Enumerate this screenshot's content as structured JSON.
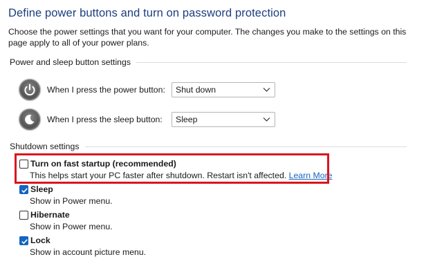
{
  "page": {
    "title": "Define power buttons and turn on password protection",
    "description": "Choose the power settings that you want for your computer. The changes you make to the settings on this page apply to all of your power plans."
  },
  "power_section": {
    "label": "Power and sleep button settings",
    "rows": [
      {
        "icon": "power-button-icon",
        "label": "When I press the power button:",
        "value": "Shut down"
      },
      {
        "icon": "sleep-button-icon",
        "label": "When I press the sleep button:",
        "value": "Sleep"
      }
    ]
  },
  "shutdown_section": {
    "label": "Shutdown settings",
    "options": [
      {
        "label": "Turn on fast startup (recommended)",
        "description": "This helps start your PC faster after shutdown. Restart isn't affected.",
        "link": "Learn More",
        "checked": false
      },
      {
        "label": "Sleep",
        "description": "Show in Power menu.",
        "checked": true
      },
      {
        "label": "Hibernate",
        "description": "Show in Power menu.",
        "checked": false
      },
      {
        "label": "Lock",
        "description": "Show in account picture menu.",
        "checked": true
      }
    ]
  },
  "colors": {
    "title": "#1c3e7f",
    "accent": "#1565c0",
    "highlight_border": "#d9141f"
  }
}
